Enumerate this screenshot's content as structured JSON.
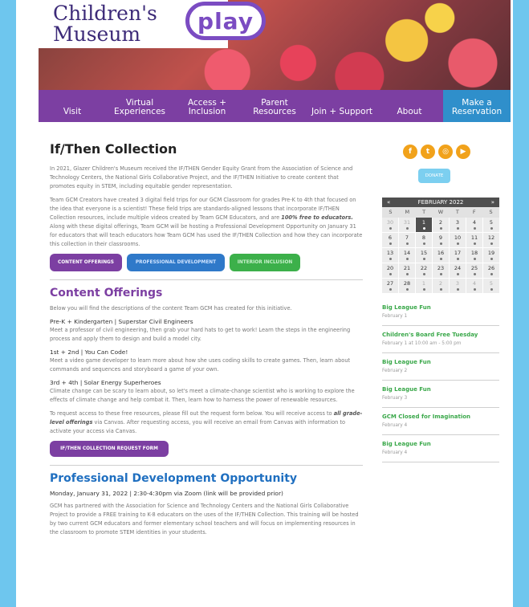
{
  "header": {
    "logo_line1": "Children's",
    "logo_line2": "Museum",
    "logo_play": "play"
  },
  "nav": [
    {
      "label": "Visit"
    },
    {
      "label": "Virtual Experiences"
    },
    {
      "label": "Access + Inclusion"
    },
    {
      "label": "Parent Resources"
    },
    {
      "label": "Join + Support"
    },
    {
      "label": "About"
    },
    {
      "label": "Make a Reservation"
    }
  ],
  "main": {
    "title": "If/Then Collection",
    "intro_p1": "In 2021, Glazer Children's Museum received the IF/THEN Gender Equity Grant from the Association of Science and Technology Centers, the National Girls Collaborative Project, and the IF/THEN Initiative to create content that promotes equity in STEM, including equitable gender representation.",
    "intro_p2_a": "Team GCM Creators have created 3 digital field trips for our GCM Classroom for grades Pre-K to 4th that focused on the idea that everyone is a scientist! These field trips are standards-aligned lessons that incorporate IF/THEN Collection resources, include multiple videos created by Team GCM Educators, and are ",
    "intro_p2_em": "100% free to educators.",
    "intro_p2_b": " Along with these digital offerings, Team GCM will be hosting a Professional Development Opportunity on January 31 for educators that will teach educators how Team GCM has used the IF/THEN Collection and how they can incorporate this collection in their classrooms.",
    "btn_content": "CONTENT OFFERINGS",
    "btn_pd": "PROFESSIONAL DEVELOPMENT",
    "btn_inclusion": "INTERIOR INCLUSION",
    "content_title": "Content Offerings",
    "content_intro": "Below you will find the descriptions of the content Team GCM has created for this initiative.",
    "offer1_title": "Pre-K + Kindergarten | Superstar Civil Engineers",
    "offer1_desc": "Meet a professor of civil engineering, then grab your hard hats to get to work! Learn the steps in the engineering process and apply them to design and build a model city.",
    "offer2_title": "1st + 2nd | You Can Code!",
    "offer2_desc": "Meet a video game developer to learn more about how she uses coding skills to create games. Then, learn about commands and sequences and storyboard a game of your own.",
    "offer3_title": "3rd + 4th | Solar Energy Superheroes",
    "offer3_desc": "Climate change can be scary to learn about, so let's meet a climate-change scientist who is working to explore the effects of climate change and help combat it. Then, learn how to harness the power of renewable resources.",
    "request_p_a": "To request access to these free resources, please fill out the request form below. You will receive access to ",
    "request_p_em": "all grade-level offerings",
    "request_p_b": " via Canvas. After requesting access, you will receive an email from Canvas with information to activate your access via Canvas.",
    "request_btn": "IF/THEN COLLECTION REQUEST FORM",
    "pd_title": "Professional Development Opportunity",
    "pd_date": "Monday, January 31, 2022 | 2:30-4:30pm via Zoom (link will be provided prior)",
    "pd_desc": "GCM has partnered with the Association for Science and Technology Centers and the National Girls Collaborative Project to provide a FREE training to K-8 educators on the uses of the IF/THEN Collection. This training will be hosted by two current GCM educators and former elementary school teachers and will focus on implementing resources in the classroom to promote STEM identities in your students."
  },
  "sidebar": {
    "social": [
      "f",
      "t",
      "◎",
      "▶"
    ],
    "donate": "DONATE",
    "calendar": {
      "prev": "«",
      "month": "FEBRUARY 2022",
      "next": "»",
      "dow": [
        "S",
        "M",
        "T",
        "W",
        "T",
        "F",
        "S"
      ],
      "days": [
        {
          "d": "30",
          "m": true
        },
        {
          "d": "31",
          "m": true
        },
        {
          "d": "1",
          "t": true
        },
        {
          "d": "2"
        },
        {
          "d": "3"
        },
        {
          "d": "4"
        },
        {
          "d": "5"
        },
        {
          "d": "6"
        },
        {
          "d": "7"
        },
        {
          "d": "8"
        },
        {
          "d": "9"
        },
        {
          "d": "10"
        },
        {
          "d": "11"
        },
        {
          "d": "12"
        },
        {
          "d": "13"
        },
        {
          "d": "14"
        },
        {
          "d": "15"
        },
        {
          "d": "16"
        },
        {
          "d": "17"
        },
        {
          "d": "18"
        },
        {
          "d": "19"
        },
        {
          "d": "20"
        },
        {
          "d": "21"
        },
        {
          "d": "22"
        },
        {
          "d": "23"
        },
        {
          "d": "24"
        },
        {
          "d": "25"
        },
        {
          "d": "26"
        },
        {
          "d": "27"
        },
        {
          "d": "28"
        },
        {
          "d": "1",
          "m": true
        },
        {
          "d": "2",
          "m": true
        },
        {
          "d": "3",
          "m": true
        },
        {
          "d": "4",
          "m": true
        },
        {
          "d": "5",
          "m": true
        }
      ]
    },
    "events": [
      {
        "title": "Big League Fun",
        "date": "February 1"
      },
      {
        "title": "Children's Board Free Tuesday",
        "date": "February 1 at 10:00 am - 5:00 pm"
      },
      {
        "title": "Big League Fun",
        "date": "February 2"
      },
      {
        "title": "Big League Fun",
        "date": "February 3"
      },
      {
        "title": "GCM Closed for Imagination",
        "date": "February 4"
      },
      {
        "title": "Big League Fun",
        "date": "February 4"
      }
    ]
  }
}
